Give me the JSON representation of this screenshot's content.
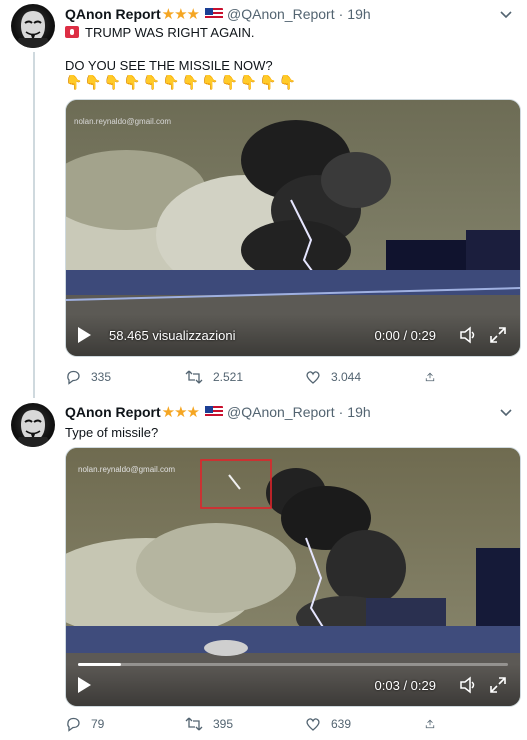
{
  "tweets": [
    {
      "display_name": "QAnon Report",
      "stars": "★★★",
      "handle": "@QAnon_Report",
      "separator": "·",
      "time": "19h",
      "text_line1": "TRUMP WAS RIGHT AGAIN.",
      "text_line2": "DO YOU SEE THE MISSILE NOW?",
      "emoji_row": "👇👇👇👇👇👇👇👇👇👇👇👇",
      "video": {
        "watermark": "nolan.reynaldo@gmail.com",
        "views": "58.465 visualizzazioni",
        "timecode": "0:00 / 0:29",
        "progress": 0.0
      },
      "replies": "335",
      "retweets": "2.521",
      "likes": "3.044"
    },
    {
      "display_name": "QAnon Report",
      "stars": "★★★",
      "handle": "@QAnon_Report",
      "separator": "·",
      "time": "19h",
      "text_line1": "Type of missile?",
      "video": {
        "watermark": "nolan.reynaldo@gmail.com",
        "timecode": "0:03 / 0:29",
        "progress": 0.1
      },
      "replies": "79",
      "retweets": "395",
      "likes": "639"
    }
  ],
  "icons": {
    "reply": "reply-icon",
    "retweet": "retweet-icon",
    "like": "heart-icon",
    "share": "share-icon",
    "volume": "volume-icon",
    "fullscreen": "fullscreen-icon",
    "more": "chevron-down-icon"
  },
  "colors": {
    "name": "#0f1419",
    "secondary": "#536471",
    "stars": "#f5a623",
    "highlight_box": "#e0242b"
  }
}
